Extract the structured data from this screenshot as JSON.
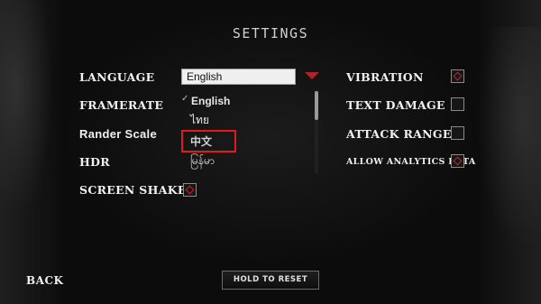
{
  "title": "SETTINGS",
  "left_settings": {
    "language": "LANGUAGE",
    "framerate": "FRAMERATE",
    "render_scale": "Rander Scale",
    "hdr": "HDR",
    "screen_shake": "SCREEN SHAKE"
  },
  "language_select": {
    "value": "English",
    "options": [
      "English",
      "ไทย",
      "中文",
      "မြန်မာ"
    ],
    "checked_option": "English",
    "highlighted_option": "中文"
  },
  "toggles": {
    "screen_shake": true,
    "vibration": true,
    "text_damage": false,
    "attack_range": false,
    "allow_analytics_data": true
  },
  "right_settings": {
    "vibration": "VIBRATION",
    "text_damage": "TEXT DAMAGE",
    "attack_range": "ATTACK RANGE",
    "allow_analytics_data": "ALLOW ANALYTICS DATA"
  },
  "buttons": {
    "back": "BACK",
    "hold_to_reset": "HOLD TO RESET"
  },
  "colors": {
    "accent": "#c8242c",
    "highlight": "#e11b1b",
    "background": "#0c0c0c"
  }
}
